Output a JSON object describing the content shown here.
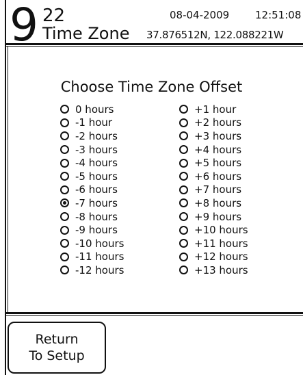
{
  "header": {
    "big_digit": "9",
    "small_digits": "22",
    "title": "Time Zone",
    "date": "08-04-2009",
    "time": "12:51:08",
    "coordinates": "37.876512N, 122.088221W"
  },
  "main": {
    "title": "Choose Time Zone Offset",
    "selected": "-7 hours",
    "left_options": [
      "0 hours",
      "-1 hour",
      "-2 hours",
      "-3 hours",
      "-4 hours",
      "-5 hours",
      "-6 hours",
      "-7 hours",
      "-8 hours",
      "-9 hours",
      "-10 hours",
      "-11 hours",
      "-12 hours"
    ],
    "right_options": [
      "+1 hour",
      "+2 hours",
      "+3 hours",
      "+4 hours",
      "+5 hours",
      "+6 hours",
      "+7 hours",
      "+8 hours",
      "+9 hours",
      "+10 hours",
      "+11 hours",
      "+12 hours",
      "+13 hours"
    ]
  },
  "footer": {
    "return_line1": "Return",
    "return_line2": "To Setup"
  }
}
